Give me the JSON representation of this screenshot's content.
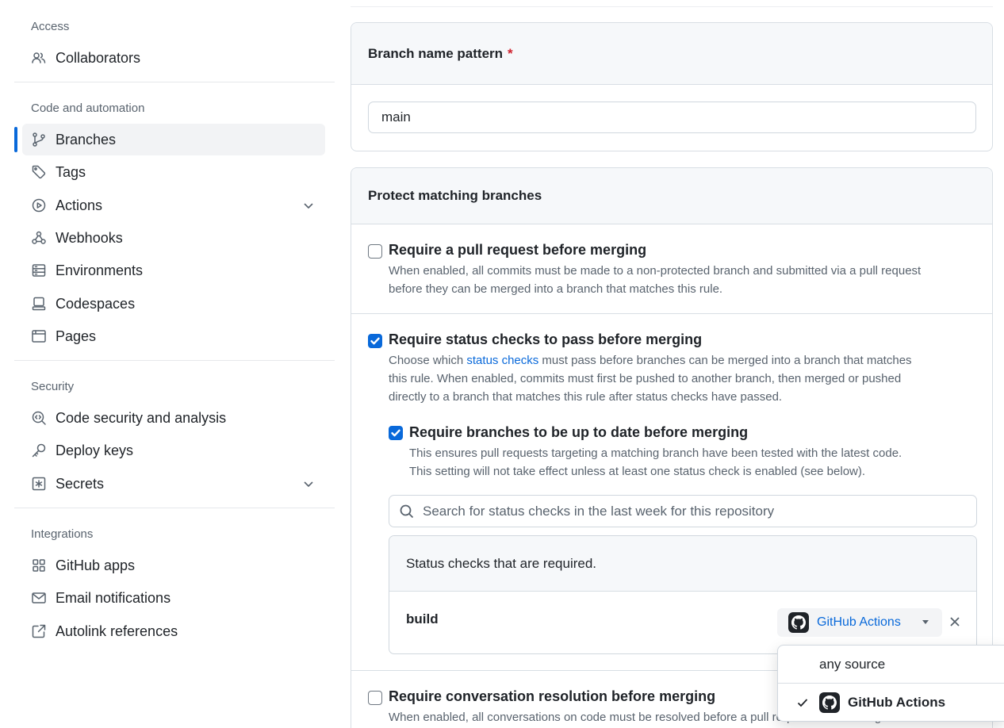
{
  "sidebar": {
    "sections": [
      {
        "label": "Access",
        "items": [
          {
            "label": "Collaborators",
            "icon": "people-icon"
          }
        ]
      },
      {
        "label": "Code and automation",
        "items": [
          {
            "label": "Branches",
            "icon": "branch-icon",
            "active": true
          },
          {
            "label": "Tags",
            "icon": "tag-icon"
          },
          {
            "label": "Actions",
            "icon": "play-icon",
            "expandable": true
          },
          {
            "label": "Webhooks",
            "icon": "webhook-icon"
          },
          {
            "label": "Environments",
            "icon": "server-icon"
          },
          {
            "label": "Codespaces",
            "icon": "codespaces-icon"
          },
          {
            "label": "Pages",
            "icon": "browser-icon"
          }
        ]
      },
      {
        "label": "Security",
        "items": [
          {
            "label": "Code security and analysis",
            "icon": "codescan-icon"
          },
          {
            "label": "Deploy keys",
            "icon": "key-icon"
          },
          {
            "label": "Secrets",
            "icon": "asterisk-icon",
            "expandable": true
          }
        ]
      },
      {
        "label": "Integrations",
        "items": [
          {
            "label": "GitHub apps",
            "icon": "apps-icon"
          },
          {
            "label": "Email notifications",
            "icon": "mail-icon"
          },
          {
            "label": "Autolink references",
            "icon": "link-external-icon"
          }
        ]
      }
    ]
  },
  "branch_pattern": {
    "label": "Branch name pattern",
    "required_mark": "*",
    "value": "main"
  },
  "protect": {
    "title": "Protect matching branches",
    "require_pr": {
      "label": "Require a pull request before merging",
      "checked": false,
      "desc_line1": "When enabled, all commits must be made to a non-protected branch and submitted via a pull request",
      "desc_line2": "before they can be merged into a branch that matches this rule."
    },
    "require_status": {
      "label": "Require status checks to pass before merging",
      "checked": true,
      "desc_pre": "Choose which ",
      "desc_link": "status checks",
      "desc_line1_post": " must pass before branches can be merged into a branch that matches",
      "desc_line2": "this rule. When enabled, commits must first be pushed to another branch, then merged or pushed",
      "desc_line3": "directly to a branch that matches this rule after status checks have passed."
    },
    "require_uptodate": {
      "label": "Require branches to be up to date before merging",
      "checked": true,
      "desc_line1": "This ensures pull requests targeting a matching branch have been tested with the latest code.",
      "desc_line2": "This setting will not take effect unless at least one status check is enabled (see below)."
    },
    "search_placeholder": "Search for status checks in the last week for this repository",
    "checks_heading": "Status checks that are required.",
    "checks": [
      {
        "name": "build",
        "source": "GitHub Actions"
      }
    ],
    "require_conversation": {
      "label": "Require conversation resolution before merging",
      "checked": false,
      "desc_visible": "When enabled, all conversations on code must be resolved before a pull request can be merged into"
    }
  },
  "source_dropdown": {
    "options": [
      {
        "label": "any source",
        "selected": false
      },
      {
        "label": "GitHub Actions",
        "selected": true
      }
    ]
  }
}
